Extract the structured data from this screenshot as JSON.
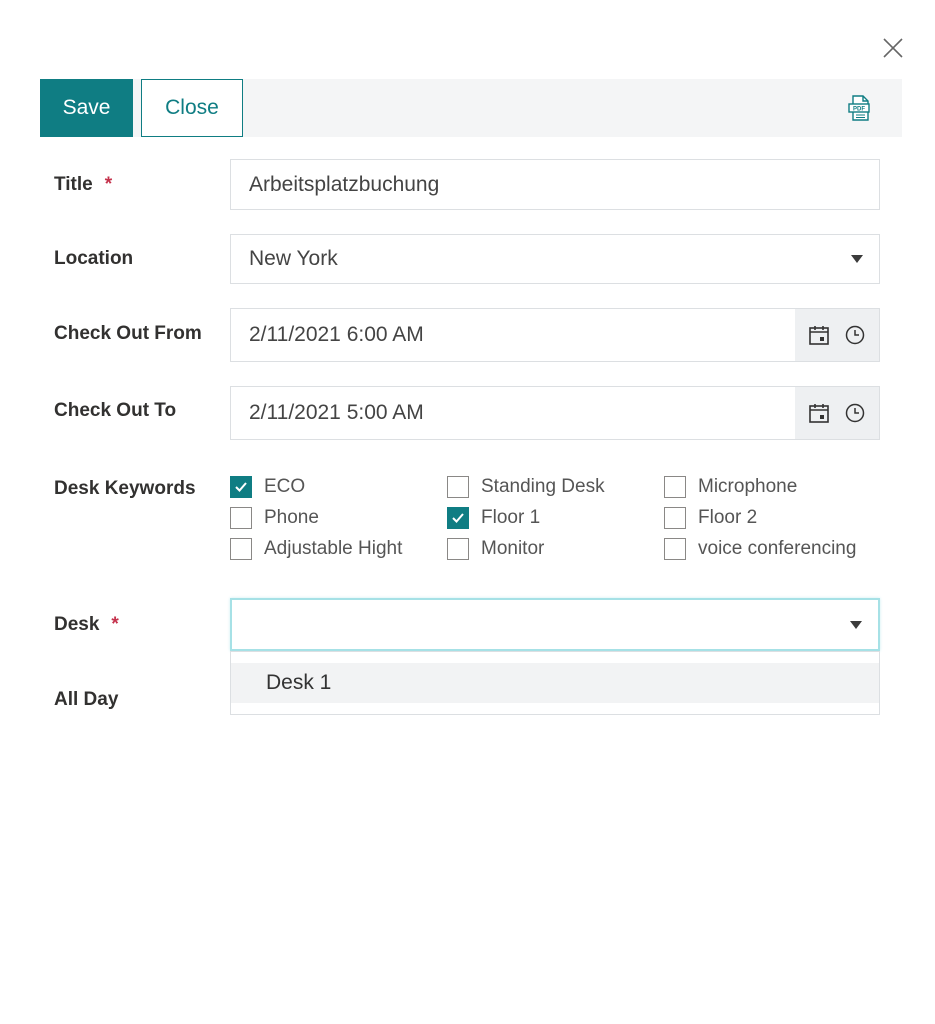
{
  "toolbar": {
    "save_label": "Save",
    "close_label": "Close"
  },
  "form": {
    "title": {
      "label": "Title",
      "required_mark": "*",
      "value": "Arbeitsplatzbuchung"
    },
    "location": {
      "label": "Location",
      "value": "New York"
    },
    "check_out_from": {
      "label": "Check Out From",
      "value": "2/11/2021 6:00 AM"
    },
    "check_out_to": {
      "label": "Check Out To",
      "value": "2/11/2021 5:00 AM"
    },
    "desk_keywords": {
      "label": "Desk Keywords",
      "options": [
        {
          "label": "ECO",
          "checked": true
        },
        {
          "label": "Standing Desk",
          "checked": false
        },
        {
          "label": "Microphone",
          "checked": false
        },
        {
          "label": "Phone",
          "checked": false
        },
        {
          "label": "Floor 1",
          "checked": true
        },
        {
          "label": "Floor 2",
          "checked": false
        },
        {
          "label": "Adjustable Hight",
          "checked": false
        },
        {
          "label": "Monitor",
          "checked": false
        },
        {
          "label": "voice conferencing",
          "checked": false
        }
      ]
    },
    "desk": {
      "label": "Desk",
      "required_mark": "*",
      "value": "",
      "dropdown_options": [
        "Desk 1"
      ]
    },
    "all_day": {
      "label": "All Day"
    }
  },
  "colors": {
    "accent": "#0f7d83",
    "required": "#c4314b",
    "focus_border": "#a6e1e6"
  },
  "icons": [
    "close-icon",
    "pdf-icon",
    "calendar-icon",
    "clock-icon",
    "chevron-down-icon",
    "checkmark-icon"
  ]
}
